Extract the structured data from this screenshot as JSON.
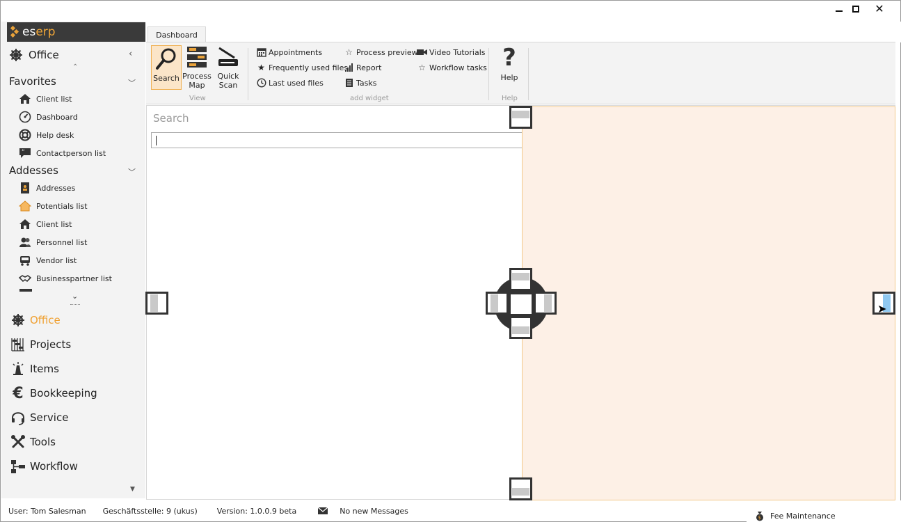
{
  "window": {
    "controls": {
      "minimize": "—",
      "maximize": "□",
      "close": "✕"
    }
  },
  "logo": {
    "es": "es",
    "erp": "erp"
  },
  "sidebar": {
    "office_header": "Office",
    "sections": [
      {
        "title": "Favorites",
        "items": [
          {
            "label": "Client list",
            "icon": "home-icon"
          },
          {
            "label": "Dashboard",
            "icon": "gauge-icon"
          },
          {
            "label": "Help desk",
            "icon": "lifebuoy-icon"
          },
          {
            "label": "Contactperson list",
            "icon": "quote-bubble-icon"
          }
        ]
      },
      {
        "title": "Addesses",
        "items": [
          {
            "label": "Addresses",
            "icon": "address-book-icon"
          },
          {
            "label": "Potentials list",
            "icon": "home-outline-icon"
          },
          {
            "label": "Client list",
            "icon": "home-icon"
          },
          {
            "label": "Personnel list",
            "icon": "people-icon"
          },
          {
            "label": "Vendor list",
            "icon": "truck-icon"
          },
          {
            "label": "Businesspartner list",
            "icon": "handshake-icon"
          }
        ]
      }
    ],
    "modules": [
      {
        "label": "Office",
        "icon": "ship-wheel-icon",
        "active": true
      },
      {
        "label": "Projects",
        "icon": "gantt-icon",
        "active": false
      },
      {
        "label": "Items",
        "icon": "items-icon",
        "active": false
      },
      {
        "label": "Bookkeeping",
        "icon": "euro-icon",
        "active": false
      },
      {
        "label": "Service",
        "icon": "headset-icon",
        "active": false
      },
      {
        "label": "Tools",
        "icon": "tools-icon",
        "active": false
      },
      {
        "label": "Workflow",
        "icon": "workflow-icon",
        "active": false
      }
    ]
  },
  "ribbon": {
    "tab": "Dashboard",
    "view": {
      "label": "View",
      "buttons": [
        {
          "label": "Search",
          "icon": "search-icon"
        },
        {
          "label": "Process\nMap",
          "icon": "process-map-icon"
        },
        {
          "label": "Quick\nScan",
          "icon": "scanner-icon"
        }
      ]
    },
    "widgets": {
      "label": "add widget",
      "items": [
        {
          "label": "Appointments",
          "icon": "calendar-icon"
        },
        {
          "label": "Frequently used files",
          "icon": "star-filled-icon"
        },
        {
          "label": "Last used files",
          "icon": "clock-icon"
        },
        {
          "label": "Process preview",
          "icon": "star-outline-icon"
        },
        {
          "label": "Report",
          "icon": "bar-signal-icon"
        },
        {
          "label": "Tasks",
          "icon": "list-icon"
        },
        {
          "label": "Video Tutorials",
          "icon": "video-camera-icon"
        },
        {
          "label": "Workflow tasks",
          "icon": "star-outline-icon"
        }
      ]
    },
    "help": {
      "label": "Help",
      "button": "Help",
      "icon": "question-icon"
    }
  },
  "content": {
    "search_title": "Search",
    "search_value": ""
  },
  "peek": {
    "label": "Fee Maintenance",
    "icon": "money-bag-icon"
  },
  "status": {
    "user": "User: Tom Salesman",
    "branch": "Geschäftsstelle: 9 (ukus)",
    "version": "Version: 1.0.0.9 beta",
    "messages": "No new Messages"
  },
  "colors": {
    "accent": "#f0a030",
    "dock_preview": "#fdf0e6",
    "logo_bg": "#3a3a3a"
  }
}
